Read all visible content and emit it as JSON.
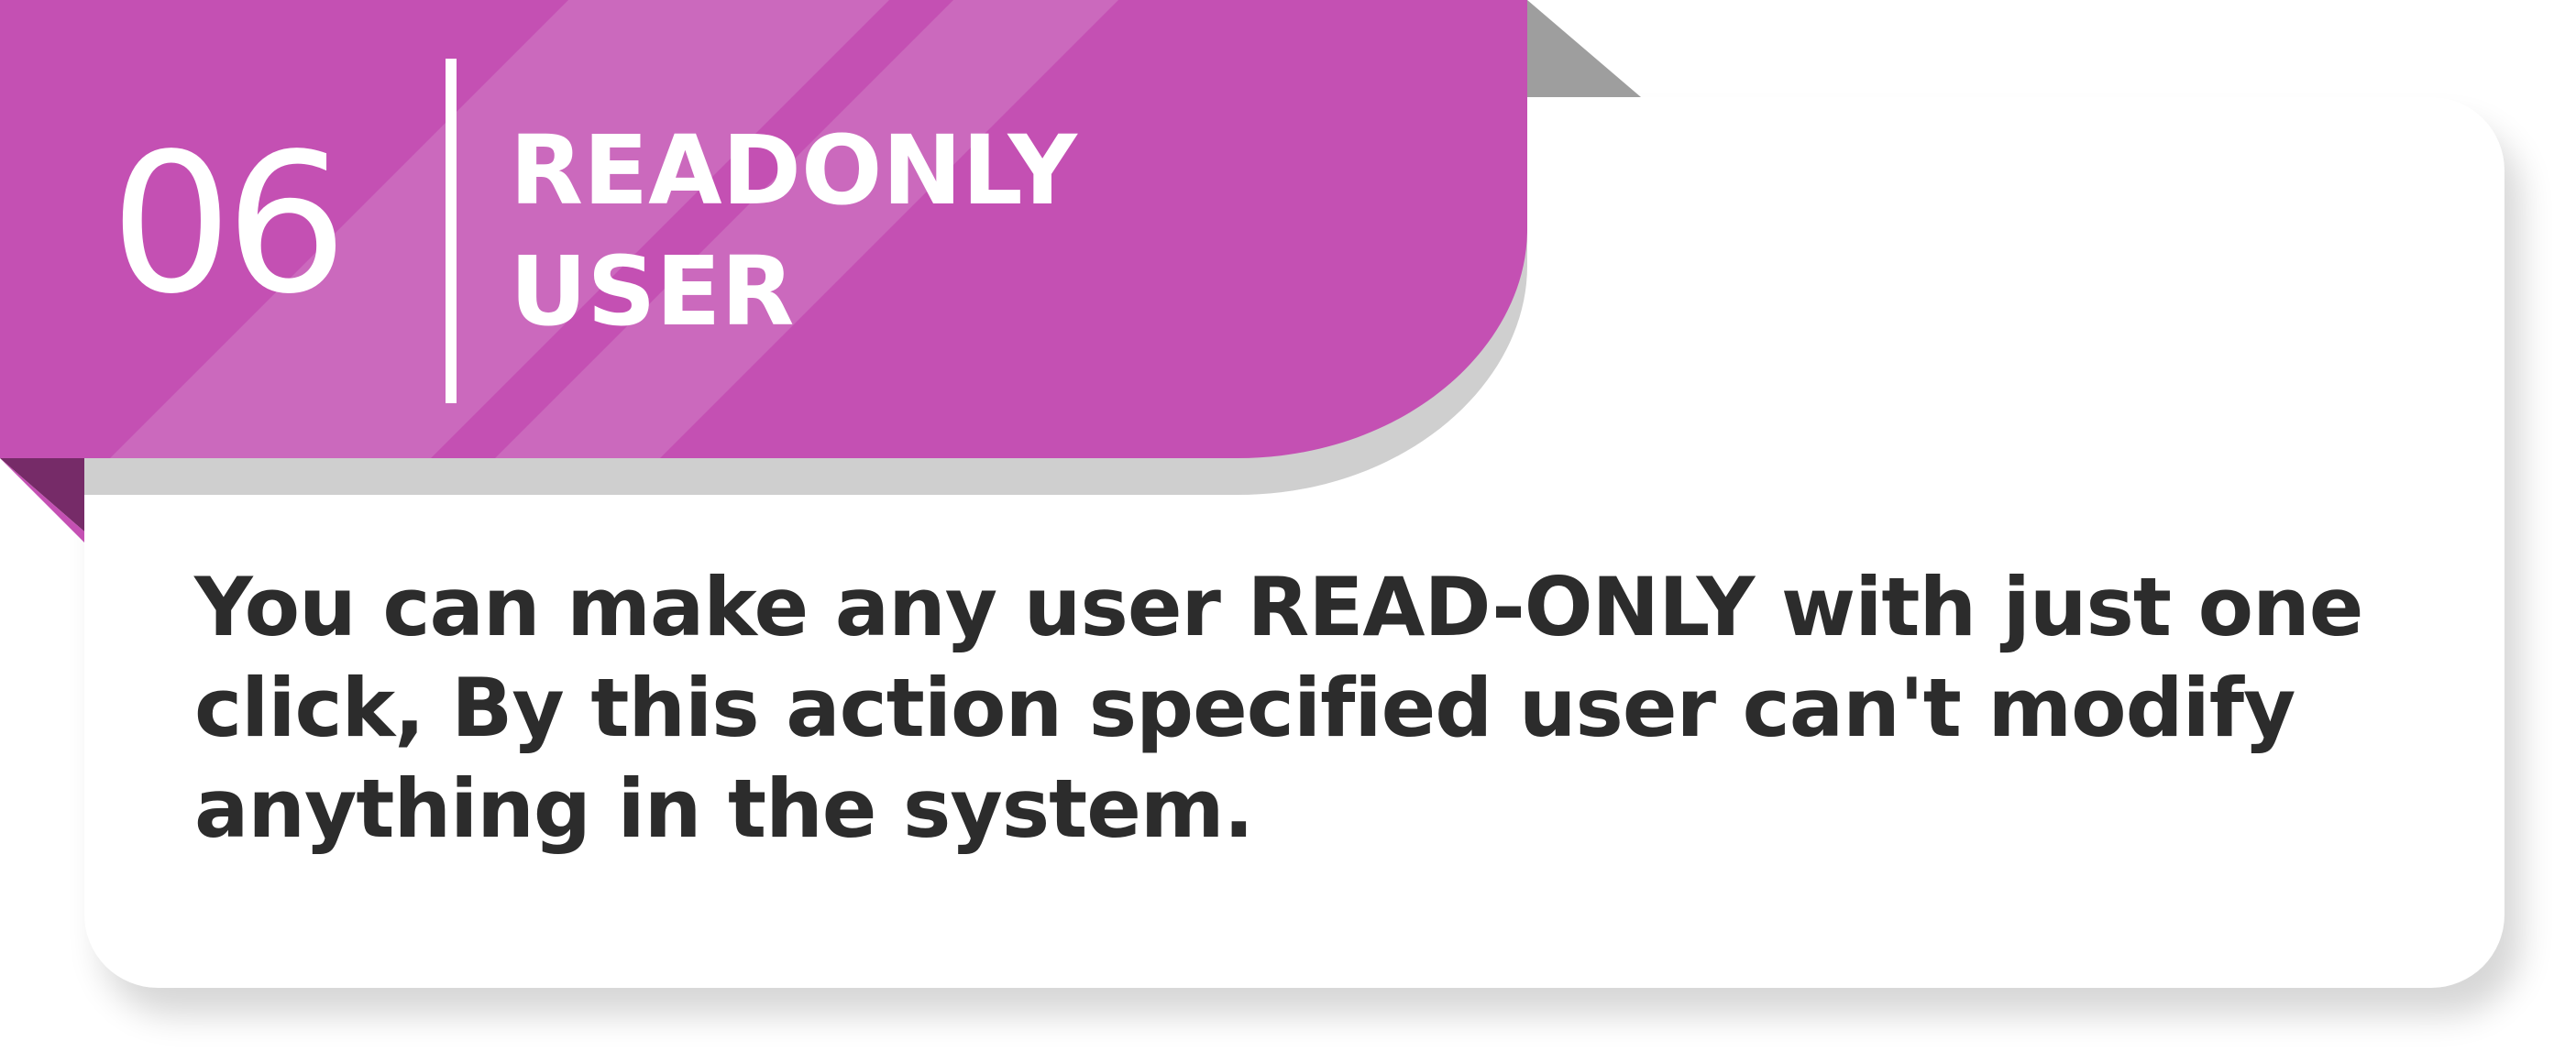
{
  "feature": {
    "number": "06",
    "title_line1": "READONLY",
    "title_line2": "USER",
    "description": "You can make any user READ-ONLY with just one click, By this action specified user can't modify anything in the system."
  },
  "colors": {
    "banner": "#c450b3",
    "banner_stripe": "#cd72c0",
    "banner_fold": "#762b68",
    "banner_shadow": "#cfcfcf",
    "corner_fold": "#9e9e9e",
    "text": "#2c2c2c",
    "card": "#ffffff"
  }
}
